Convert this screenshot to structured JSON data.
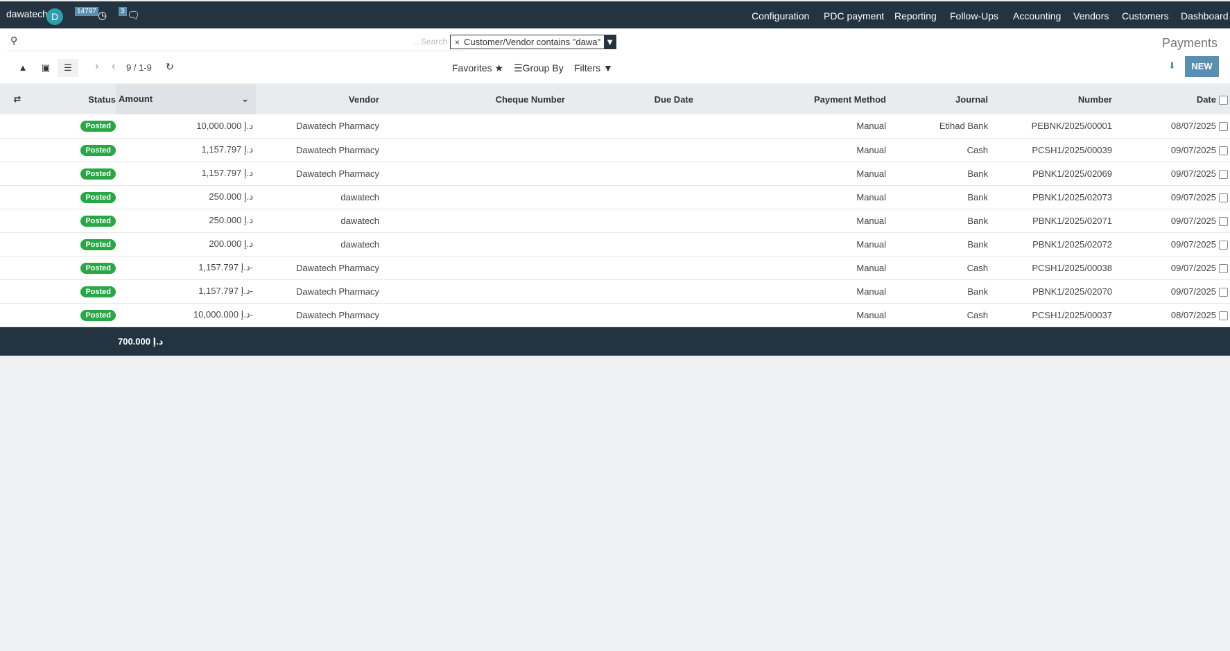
{
  "topbar": {
    "user": "dawatech",
    "avatar_letter": "D",
    "activity_count": "14797",
    "message_count": "3",
    "menu": [
      "Configuration",
      "PDC payment",
      "Reporting",
      "Follow-Ups",
      "Accounting",
      "Vendors",
      "Customers",
      "Dashboard"
    ]
  },
  "search": {
    "placeholder": "...Search",
    "facet": "Customer/Vendor contains \"dawa\""
  },
  "page_title": "Payments",
  "toolbar": {
    "pager": "9 / 1-9",
    "favorites": "Favorites",
    "group_by": "Group By",
    "filters": "Filters",
    "new": "NEW"
  },
  "columns": {
    "status": "Status",
    "amount": "Amount",
    "vendor": "Vendor",
    "cheque": "Cheque Number",
    "due": "Due Date",
    "method": "Payment Method",
    "journal": "Journal",
    "number": "Number",
    "date": "Date"
  },
  "rows": [
    {
      "status": "Posted",
      "amount": "د.إ  10,000.000",
      "vendor": "Dawatech Pharmacy",
      "method": "Manual",
      "journal": "Etihad Bank",
      "number": "PEBNK/2025/00001",
      "date": "08/07/2025"
    },
    {
      "status": "Posted",
      "amount": "د.إ  1,157.797",
      "vendor": "Dawatech Pharmacy",
      "method": "Manual",
      "journal": "Cash",
      "number": "PCSH1/2025/00039",
      "date": "09/07/2025"
    },
    {
      "status": "Posted",
      "amount": "د.إ  1,157.797",
      "vendor": "Dawatech Pharmacy",
      "method": "Manual",
      "journal": "Bank",
      "number": "PBNK1/2025/02069",
      "date": "09/07/2025"
    },
    {
      "status": "Posted",
      "amount": "د.إ  250.000",
      "vendor": "dawatech",
      "method": "Manual",
      "journal": "Bank",
      "number": "PBNK1/2025/02073",
      "date": "09/07/2025"
    },
    {
      "status": "Posted",
      "amount": "د.إ  250.000",
      "vendor": "dawatech",
      "method": "Manual",
      "journal": "Bank",
      "number": "PBNK1/2025/02071",
      "date": "09/07/2025"
    },
    {
      "status": "Posted",
      "amount": "د.إ  200.000",
      "vendor": "dawatech",
      "method": "Manual",
      "journal": "Bank",
      "number": "PBNK1/2025/02072",
      "date": "09/07/2025"
    },
    {
      "status": "Posted",
      "amount": "د.إ  1,157.797-",
      "vendor": "Dawatech Pharmacy",
      "method": "Manual",
      "journal": "Cash",
      "number": "PCSH1/2025/00038",
      "date": "09/07/2025"
    },
    {
      "status": "Posted",
      "amount": "د.إ  1,157.797-",
      "vendor": "Dawatech Pharmacy",
      "method": "Manual",
      "journal": "Bank",
      "number": "PBNK1/2025/02070",
      "date": "09/07/2025"
    },
    {
      "status": "Posted",
      "amount": "د.إ  10,000.000-",
      "vendor": "Dawatech Pharmacy",
      "method": "Manual",
      "journal": "Cash",
      "number": "PCSH1/2025/00037",
      "date": "08/07/2025"
    }
  ],
  "total": "د.إ  700.000"
}
